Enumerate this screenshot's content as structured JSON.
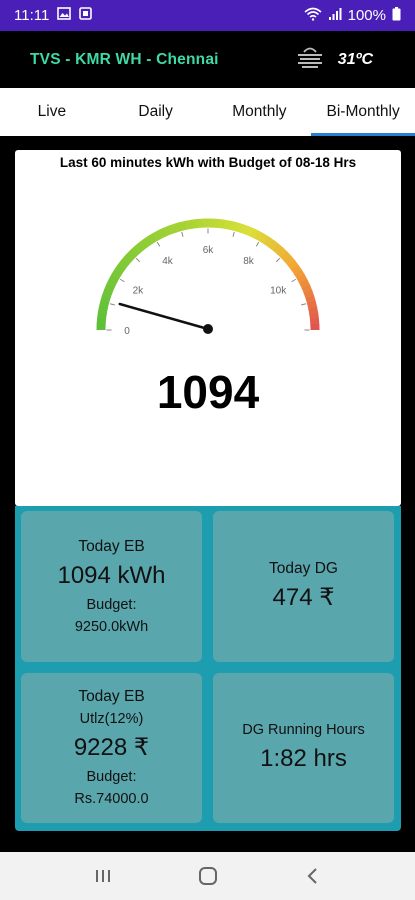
{
  "status": {
    "time": "11:11",
    "battery": "100%",
    "left_icons": [
      "image-icon",
      "square-icon"
    ],
    "right_icons": [
      "wifi-calling-icon",
      "signal-icon",
      "battery-icon"
    ]
  },
  "header": {
    "title": "TVS - KMR WH - Chennai",
    "weather_icon": "haze-icon",
    "temperature": "31ºC"
  },
  "tabs": [
    {
      "label": "Live",
      "active": false
    },
    {
      "label": "Daily",
      "active": false
    },
    {
      "label": "Monthly",
      "active": false
    },
    {
      "label": "Bi-Monthly",
      "active": true
    }
  ],
  "gauge": {
    "title": "Last 60 minutes kWh with Budget of 08-18 Hrs",
    "value": "1094",
    "min": 0,
    "max": 12000,
    "reading": 1094,
    "tick_labels": [
      "0",
      "2k",
      "4k",
      "6k",
      "8k",
      "10k"
    ],
    "colors": {
      "green": "#5cbf3a",
      "yellow": "#d9e03a",
      "orange": "#f2a634",
      "red": "#e05050"
    }
  },
  "tiles": {
    "today_eb": {
      "label": "Today EB",
      "value": "1094 kWh",
      "budget_label": "Budget:",
      "budget_value": "9250.0kWh"
    },
    "today_dg": {
      "label": "Today DG",
      "value": "474 ₹"
    },
    "today_eb_util": {
      "label": "Today EB",
      "util": "Utlz(12%)",
      "value": "9228 ₹",
      "budget_label": "Budget:",
      "budget_value": "Rs.74000.0"
    },
    "dg_hours": {
      "label": "DG Running Hours",
      "value": "1:82 hrs"
    }
  },
  "nav": {
    "recents": "recents-icon",
    "home": "home-icon",
    "back": "back-icon"
  }
}
